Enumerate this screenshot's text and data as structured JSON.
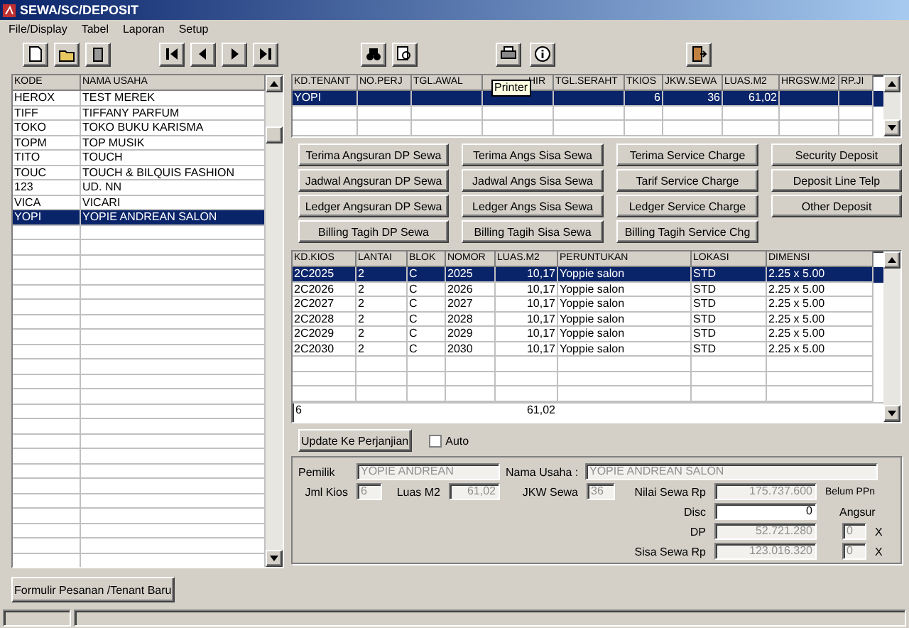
{
  "window": {
    "title": "SEWA/SC/DEPOSIT"
  },
  "menu": [
    "File/Display",
    "Tabel",
    "Laporan",
    "Setup"
  ],
  "toolbar": {
    "tooltip": "Printer"
  },
  "tenant_list": {
    "columns": [
      "KODE",
      "NAMA USAHA"
    ],
    "rows": [
      {
        "code": "HEROX",
        "name": "TEST MEREK",
        "selected": false
      },
      {
        "code": "TIFF",
        "name": "TIFFANY PARFUM",
        "selected": false
      },
      {
        "code": "TOKO",
        "name": "TOKO BUKU KARISMA",
        "selected": false
      },
      {
        "code": "TOPM",
        "name": "TOP MUSIK",
        "selected": false
      },
      {
        "code": "TITO",
        "name": "TOUCH",
        "selected": false
      },
      {
        "code": "TOUC",
        "name": "TOUCH & BILQUIS FASHION",
        "selected": false
      },
      {
        "code": "123",
        "name": "UD. NN",
        "selected": false
      },
      {
        "code": "VICA",
        "name": "VICARI",
        "selected": false
      },
      {
        "code": "YOPI",
        "name": "YOPIE ANDREAN SALON",
        "selected": true
      }
    ]
  },
  "contract_table": {
    "columns": [
      "KD.TENANT",
      "NO.PERJ",
      "TGL.AWAL",
      "HIR",
      "TGL.SERAHT",
      "TKIOS",
      "JKW.SEWA",
      "LUAS.M2",
      "HRGSW.M2",
      "RP.JI"
    ],
    "rows": [
      {
        "cells": [
          "YOPI",
          "",
          "",
          "",
          "",
          "6",
          "36",
          "61,02",
          "",
          ""
        ],
        "selected": true
      }
    ]
  },
  "action_buttons": [
    [
      "Terima Angsuran DP Sewa",
      "Terima Angs Sisa Sewa",
      "Terima Service Charge",
      "Security Deposit"
    ],
    [
      "Jadwal Angsuran DP Sewa",
      "Jadwal Angs Sisa Sewa",
      "Tarif Service Charge",
      "Deposit Line Telp"
    ],
    [
      "Ledger Angsuran DP Sewa",
      "Ledger Angs Sisa Sewa",
      "Ledger Service Charge",
      "Other Deposit"
    ],
    [
      "Billing Tagih DP Sewa",
      "Billing Tagih Sisa Sewa",
      "Billing Tagih Service Chg"
    ]
  ],
  "kiosk_table": {
    "columns": [
      "KD.KIOS",
      "LANTAI",
      "BLOK",
      "NOMOR",
      "LUAS.M2",
      "PERUNTUKAN",
      "LOKASI",
      "DIMENSI"
    ],
    "rows": [
      {
        "cells": [
          "2C2025",
          "2",
          "C",
          "2025",
          "10,17",
          "Yoppie salon",
          "STD",
          "2.25 x  5.00"
        ],
        "selected": true
      },
      {
        "cells": [
          "2C2026",
          "2",
          "C",
          "2026",
          "10,17",
          "Yoppie salon",
          "STD",
          "2.25 x  5.00"
        ],
        "selected": false
      },
      {
        "cells": [
          "2C2027",
          "2",
          "C",
          "2027",
          "10,17",
          "Yoppie salon",
          "STD",
          "2.25 x  5.00"
        ],
        "selected": false
      },
      {
        "cells": [
          "2C2028",
          "2",
          "C",
          "2028",
          "10,17",
          "Yoppie salon",
          "STD",
          "2.25 x  5.00"
        ],
        "selected": false
      },
      {
        "cells": [
          "2C2029",
          "2",
          "C",
          "2029",
          "10,17",
          "Yoppie salon",
          "STD",
          "2.25 x  5.00"
        ],
        "selected": false
      },
      {
        "cells": [
          "2C2030",
          "2",
          "C",
          "2030",
          "10,17",
          "Yoppie salon",
          "STD",
          "2.25 x  5.00"
        ],
        "selected": false
      }
    ],
    "footer": {
      "count": "6",
      "area": "61,02"
    }
  },
  "update_button": "Update Ke Perjanjian",
  "auto_checkbox": {
    "label": "Auto",
    "checked": false
  },
  "details": {
    "owner": {
      "label": "Pemilik",
      "value": "YOPIE ANDREAN",
      "disabled": true
    },
    "business": {
      "label": "Nama Usaha :",
      "value": "YOPIE ANDREAN SALON",
      "disabled": true
    },
    "kiosk_count": {
      "label": "Jml Kios",
      "value": "6",
      "disabled": true
    },
    "area": {
      "label": "Luas M2",
      "value": "61,02",
      "disabled": true
    },
    "term": {
      "label": "JKW Sewa",
      "value": "36",
      "disabled": true
    },
    "rent": {
      "label": "Nilai Sewa Rp",
      "value": "175.737.600",
      "disabled": true
    },
    "vat_note": "Belum PPn",
    "discount": {
      "label": "Disc",
      "value": "0",
      "disabled": false
    },
    "installment_label": "Angsur",
    "dp": {
      "label": "DP",
      "value": "52.721.280",
      "disabled": true,
      "installments": "0",
      "times": "X"
    },
    "balance": {
      "label": "Sisa Sewa Rp",
      "value": "123.016.320",
      "disabled": true,
      "installments": "0",
      "times": "X"
    }
  },
  "new_tenant_button": "Formulir Pesanan /Tenant Baru"
}
